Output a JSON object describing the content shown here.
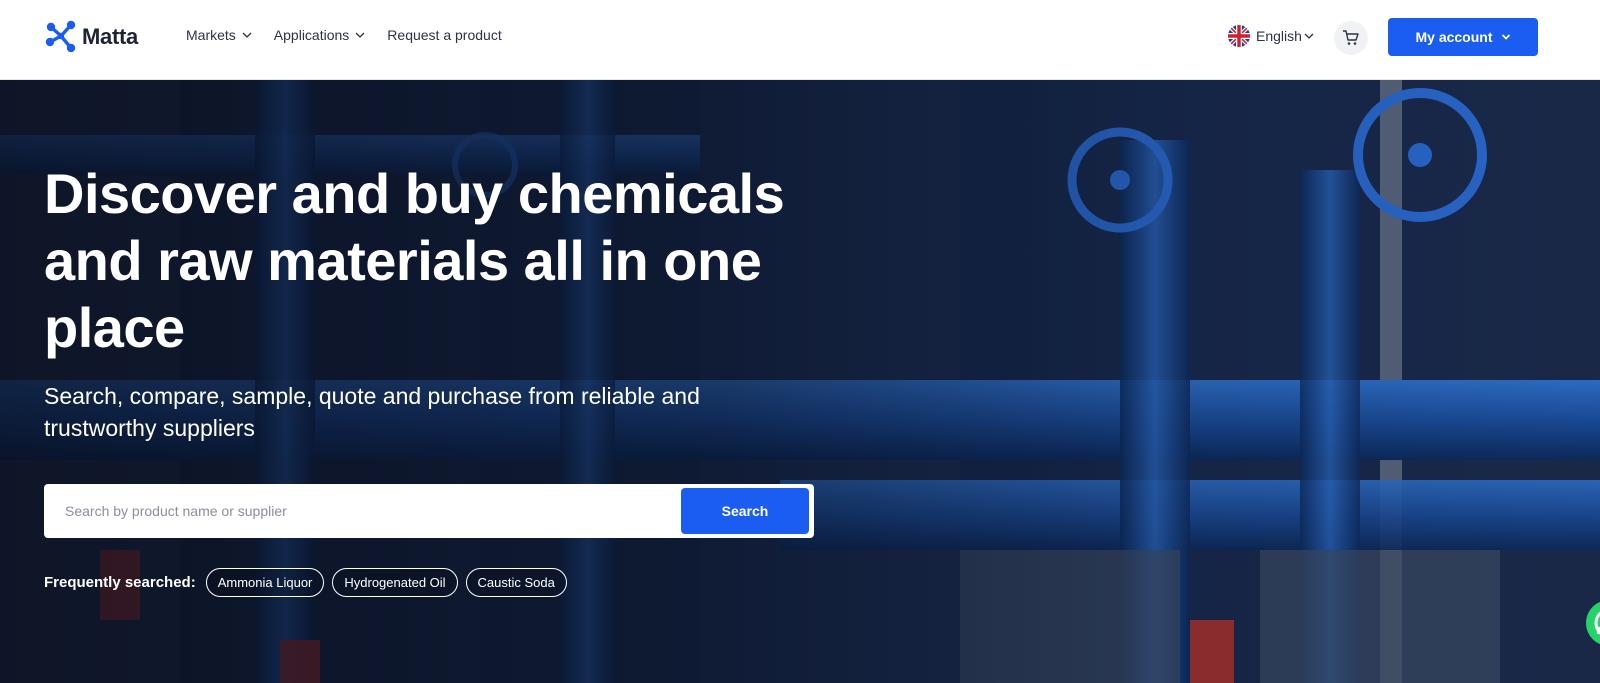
{
  "brand": {
    "name": "Matta"
  },
  "nav": {
    "items": [
      {
        "label": "Markets",
        "has_dropdown": true
      },
      {
        "label": "Applications",
        "has_dropdown": true
      },
      {
        "label": "Request a product",
        "has_dropdown": false
      }
    ]
  },
  "header": {
    "language": "English",
    "account_label": "My account",
    "icons": {
      "flag": "uk-flag-icon",
      "cart": "cart-icon"
    }
  },
  "hero": {
    "title": "Discover and buy chemicals and raw materials all in one place",
    "subtitle": "Search, compare, sample, quote and purchase from reliable and trustworthy suppliers",
    "search": {
      "placeholder": "Search by product name or supplier",
      "value": "",
      "button_label": "Search"
    },
    "frequently_searched": {
      "label": "Frequently searched:",
      "chips": [
        "Ammonia Liquor",
        "Hydrogenated Oil",
        "Caustic Soda"
      ]
    }
  },
  "colors": {
    "accent": "#1a5df0",
    "text_dark": "#1d2433",
    "hero_overlay": "#0d1f3e"
  }
}
